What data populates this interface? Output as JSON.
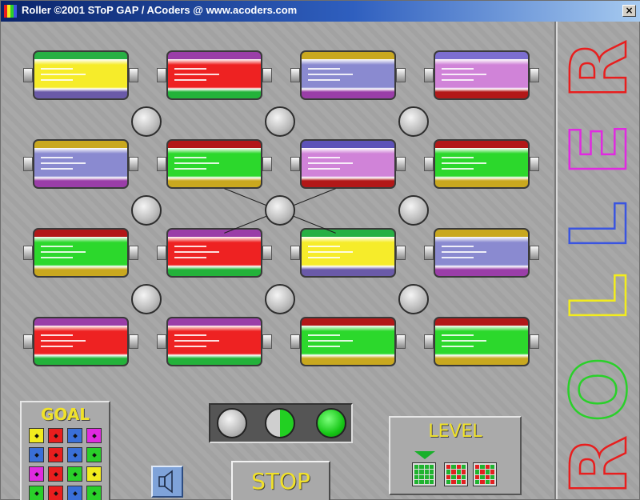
{
  "window": {
    "title": "Roller ©2001 SToP GAP / ACoders @ www.acoders.com",
    "close_label": "×"
  },
  "game": {
    "rows": [
      [
        {
          "top": "#27b044",
          "mid": "#f6ec2a",
          "bot": "#6a5aa8"
        },
        {
          "top": "#9a3ea8",
          "mid": "#ee2222",
          "bot": "#23b23a"
        },
        {
          "top": "#c9a81f",
          "mid": "#8a8ad0",
          "bot": "#9a3ea8"
        },
        {
          "top": "#7c6ed0",
          "mid": "#d083d8",
          "bot": "#b21818"
        }
      ],
      [
        {
          "top": "#c9a81f",
          "mid": "#8a8ad0",
          "bot": "#9a3ea8"
        },
        {
          "top": "#b21818",
          "mid": "#2cd82c",
          "bot": "#c9a81f"
        },
        {
          "top": "#5d52b8",
          "mid": "#d083d8",
          "bot": "#b21818"
        },
        {
          "top": "#b21818",
          "mid": "#2cd82c",
          "bot": "#c9a81f"
        }
      ],
      [
        {
          "top": "#b21818",
          "mid": "#2cd82c",
          "bot": "#c9a81f"
        },
        {
          "top": "#9a3ea8",
          "mid": "#ee2222",
          "bot": "#23b23a"
        },
        {
          "top": "#27b044",
          "mid": "#f6ec2a",
          "bot": "#6a5aa8"
        },
        {
          "top": "#c9a81f",
          "mid": "#8a8ad0",
          "bot": "#9a3ea8"
        }
      ],
      [
        {
          "top": "#9a3ea8",
          "mid": "#ee2222",
          "bot": "#23b23a"
        },
        {
          "top": "#9a3ea8",
          "mid": "#ee2222",
          "bot": "#23b23a"
        },
        {
          "top": "#b21818",
          "mid": "#2cd82c",
          "bot": "#c9a81f"
        },
        {
          "top": "#b21818",
          "mid": "#2cd82c",
          "bot": "#c9a81f"
        }
      ]
    ],
    "selected_peg": "row-2-middle"
  },
  "goal": {
    "label": "GOAL",
    "grid": [
      [
        "#f2ec1e",
        "#e81e1e",
        "#3a6fd8",
        "#e02ae0"
      ],
      [
        "#3a6fd8",
        "#e81e1e",
        "#3a6fd8",
        "#2ad02a"
      ],
      [
        "#e02ae0",
        "#e81e1e",
        "#2ad02a",
        "#f2ec1e"
      ],
      [
        "#2ad02a",
        "#e81e1e",
        "#3a6fd8",
        "#2ad02a"
      ]
    ]
  },
  "status_lights": [
    "off",
    "half",
    "on"
  ],
  "controls": {
    "sound_icon": "speaker-icon",
    "stop_label": "STOP"
  },
  "level": {
    "label": "LEVEL",
    "selected_index": 0,
    "option_count": 3
  },
  "side_logo": {
    "letters": [
      "R",
      "E",
      "L",
      "L",
      "O",
      "R"
    ],
    "colors": [
      "#e81e1e",
      "#e02ae0",
      "#3a55e0",
      "#f2ec1e",
      "#2ad02a",
      "#e81e1e"
    ]
  }
}
